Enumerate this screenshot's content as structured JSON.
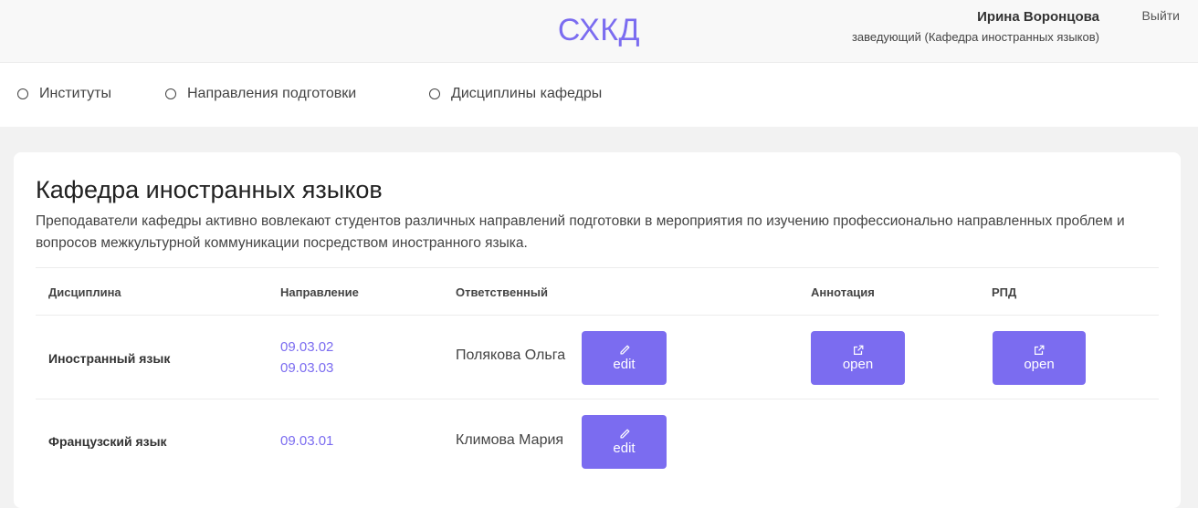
{
  "header": {
    "logo": "СХКД",
    "user_name": "Ирина Воронцова",
    "user_role": "заведующий (Кафедра иностранных языков)",
    "logout": "Выйти"
  },
  "nav": {
    "items": [
      {
        "label": "Институты"
      },
      {
        "label": "Направления подготовки"
      },
      {
        "label": "Дисциплины кафедры"
      }
    ]
  },
  "department": {
    "title": "Кафедра иностранных языков",
    "description": "Преподаватели кафедры активно вовлекают студентов различных направлений подготовки в мероприятия по изучению профессионально направленных проблем и вопросов межкультурной коммуникации посредством иностранного языка."
  },
  "table": {
    "headers": {
      "discipline": "Дисциплина",
      "direction": "Направление",
      "responsible": "Ответственный",
      "annotation": "Аннотация",
      "rpd": "РПД"
    },
    "rows": [
      {
        "discipline": "Иностранный язык",
        "directions": [
          "09.03.02",
          "09.03.03"
        ],
        "responsible": "Полякова Ольга",
        "edit_label": "edit",
        "annotation_label": "open",
        "rpd_label": "open"
      },
      {
        "discipline": "Французский язык",
        "directions": [
          "09.03.01"
        ],
        "responsible": "Климова Мария",
        "edit_label": "edit"
      }
    ]
  },
  "colors": {
    "accent": "#7b6cf0",
    "header_bg": "#f8f8f8",
    "page_bg": "#f2f2f2"
  }
}
